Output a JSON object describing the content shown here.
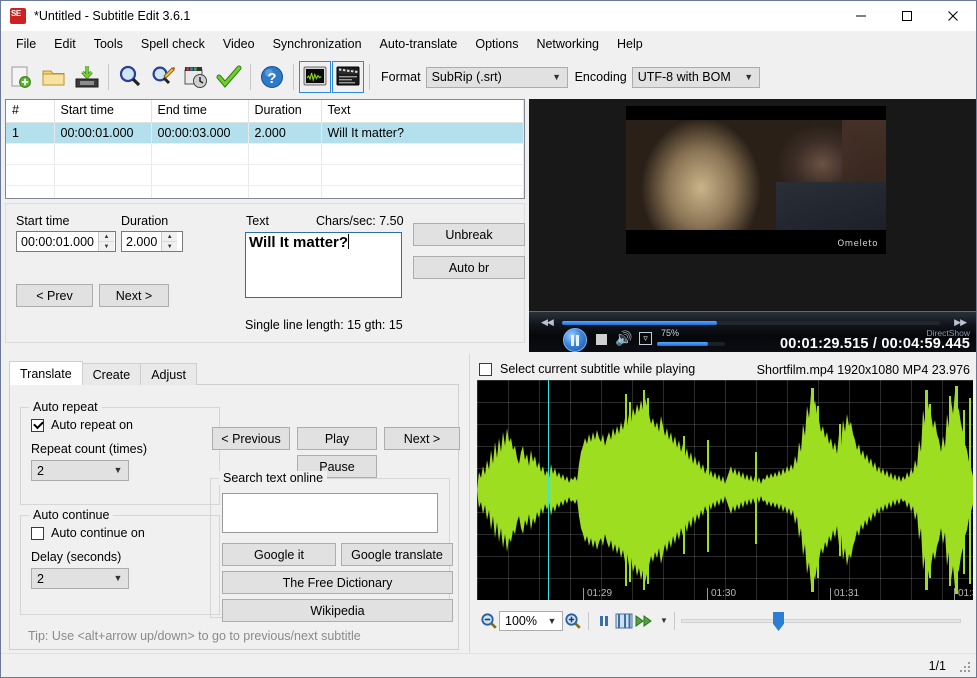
{
  "window": {
    "title": "*Untitled - Subtitle Edit 3.6.1",
    "app_icon": "subtitle-edit-icon",
    "minimize": "—",
    "maximize": "□",
    "close": "✕"
  },
  "menubar": {
    "items": [
      {
        "label": "File"
      },
      {
        "label": "Edit"
      },
      {
        "label": "Tools"
      },
      {
        "label": "Spell check"
      },
      {
        "label": "Video"
      },
      {
        "label": "Synchronization"
      },
      {
        "label": "Auto-translate"
      },
      {
        "label": "Options"
      },
      {
        "label": "Networking"
      },
      {
        "label": "Help"
      }
    ]
  },
  "toolbar": {
    "buttons": [
      {
        "name": "new-file-icon",
        "glyph": "new"
      },
      {
        "name": "open-file-icon",
        "glyph": "folder"
      },
      {
        "name": "save-file-icon",
        "glyph": "save"
      },
      {
        "name": "find-icon",
        "glyph": "magnifier"
      },
      {
        "name": "replace-icon",
        "glyph": "magnifier-pencil"
      },
      {
        "name": "sync-icon",
        "glyph": "clapper-clock"
      },
      {
        "name": "spell-check-icon",
        "glyph": "check"
      },
      {
        "name": "help-icon",
        "glyph": "question"
      },
      {
        "name": "toggle-waveform-icon",
        "glyph": "waveform"
      },
      {
        "name": "toggle-video-icon",
        "glyph": "clapper"
      }
    ],
    "format_label": "Format",
    "format_value": "SubRip (.srt)",
    "encoding_label": "Encoding",
    "encoding_value": "UTF-8 with BOM"
  },
  "subtitle_list": {
    "columns": [
      "#",
      "Start time",
      "End time",
      "Duration",
      "Text"
    ],
    "rows": [
      {
        "number": "1",
        "start": "00:00:01.000",
        "end": "00:00:03.000",
        "duration": "2.000",
        "text": "Will It matter?",
        "selected": true
      }
    ],
    "empty_rows": 3
  },
  "edit_panel": {
    "start_time_label": "Start time",
    "start_time_value": "00:00:01.000",
    "duration_label": "Duration",
    "duration_value": "2.000",
    "prev_label": "< Prev",
    "next_label": "Next >",
    "text_label": "Text",
    "chars_per_sec": "Chars/sec: 7.50",
    "text_value": "Will It matter?",
    "single_line_length": "Single line length: 15 gth: 15",
    "unbreak_label": "Unbreak",
    "autobr_label": "Auto br"
  },
  "video": {
    "watermark": "Omeleto",
    "progress_percent": 30,
    "pause_icon": "pause-icon",
    "stop_icon": "stop-icon",
    "volume_icon": "speaker-icon",
    "fullscreen_icon": "fullscreen-icon",
    "rewind_icon": "rewind-icon",
    "forward_icon": "forward-icon",
    "volume_label": "75%",
    "volume_percent": 75,
    "engine_label": "DirectShow",
    "time_label": "00:01:29.515 / 00:04:59.445"
  },
  "tabs": {
    "items": [
      {
        "label": "Translate",
        "selected": true
      },
      {
        "label": "Create",
        "selected": false
      },
      {
        "label": "Adjust",
        "selected": false
      }
    ]
  },
  "translate_tab": {
    "auto_repeat_caption": "Auto repeat",
    "auto_repeat_on_label": "Auto repeat on",
    "auto_repeat_on_checked": true,
    "repeat_count_label": "Repeat count (times)",
    "repeat_count_value": "2",
    "auto_continue_caption": "Auto continue",
    "auto_continue_on_label": "Auto continue on",
    "auto_continue_on_checked": false,
    "delay_label": "Delay (seconds)",
    "delay_value": "2",
    "previous_label": "< Previous",
    "play_label": "Play",
    "next_label": "Next >",
    "pause_label": "Pause",
    "search_caption": "Search text online",
    "search_value": "",
    "google_it_label": "Google it",
    "google_translate_label": "Google translate",
    "free_dictionary_label": "The Free Dictionary",
    "wikipedia_label": "Wikipedia",
    "tip": "Tip: Use <alt+arrow up/down> to go to previous/next subtitle"
  },
  "waveform": {
    "select_current_label": "Select current subtitle while playing",
    "select_current_checked": false,
    "video_info": "Shortfilm.mp4 1920x1080 MP4 23.976",
    "time_labels": [
      "01:29",
      "01:30",
      "01:31",
      "01:3"
    ],
    "zoom_out_icon": "zoom-out-icon",
    "zoom_in_icon": "zoom-in-icon",
    "zoom_value": "100%",
    "pause_icon": "pause-icon",
    "scene_icon": "filmstrip-icon",
    "fast_forward_icon": "fast-forward-icon",
    "dropdown_icon": "chevron-down-icon",
    "slider_position_percent": 33
  },
  "statusbar": {
    "count": "1/1",
    "grip": "resize-grip"
  },
  "colors": {
    "accent_blue": "#2e8ad8",
    "selection_blue": "#b3e0ec",
    "waveform_green": "#9ede21",
    "playhead_cyan": "#2ee8e8",
    "window_chrome": "#f0f0f0",
    "text_border_blue": "#2f6fa8"
  }
}
